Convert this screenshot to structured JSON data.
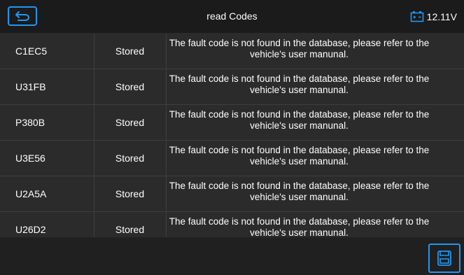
{
  "header": {
    "title": "read Codes",
    "voltage": "12.11V",
    "back_icon": "back-arrow-icon",
    "battery_icon": "battery-icon"
  },
  "codes": [
    {
      "code": "C1EC5",
      "status": "Stored",
      "description": "The fault code is not found in the database, please refer to the vehicle's user manunal."
    },
    {
      "code": "U31FB",
      "status": "Stored",
      "description": "The fault code is not found in the database, please refer to the vehicle's user manunal."
    },
    {
      "code": "P380B",
      "status": "Stored",
      "description": "The fault code is not found in the database, please refer to the vehicle's user manunal."
    },
    {
      "code": "U3E56",
      "status": "Stored",
      "description": "The fault code is not found in the database, please refer to the vehicle's user manunal."
    },
    {
      "code": "U2A5A",
      "status": "Stored",
      "description": "The fault code is not found in the database, please refer to the vehicle's user manunal."
    },
    {
      "code": "U26D2",
      "status": "Stored",
      "description": "The fault code is not found in the database, please refer to the vehicle's user manunal."
    }
  ],
  "footer": {
    "save_icon": "save-icon"
  },
  "colors": {
    "accent": "#2196f3",
    "background": "#232323",
    "row": "#2b2b2b"
  }
}
